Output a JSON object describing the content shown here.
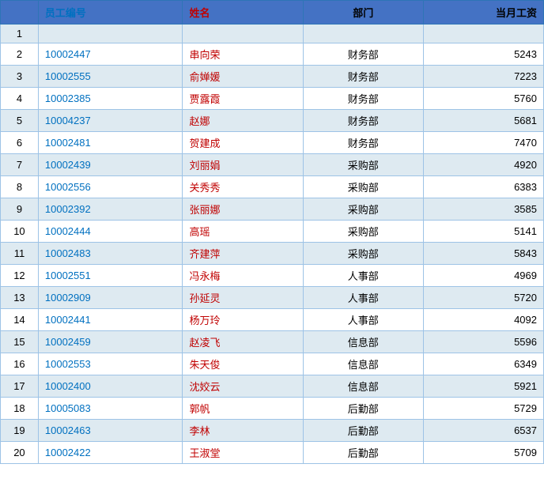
{
  "table": {
    "headers": [
      "",
      "员工编号",
      "姓名",
      "部门",
      "当月工资"
    ],
    "rows": [
      {
        "index": "1",
        "id": "",
        "name": "",
        "dept": "",
        "salary": ""
      },
      {
        "index": "2",
        "id": "10002447",
        "name": "串向荣",
        "dept": "财务部",
        "salary": "5243"
      },
      {
        "index": "3",
        "id": "10002555",
        "name": "俞婵媛",
        "dept": "财务部",
        "salary": "7223"
      },
      {
        "index": "4",
        "id": "10002385",
        "name": "贾露霞",
        "dept": "财务部",
        "salary": "5760"
      },
      {
        "index": "5",
        "id": "10004237",
        "name": "赵娜",
        "dept": "财务部",
        "salary": "5681"
      },
      {
        "index": "6",
        "id": "10002481",
        "name": "贺建成",
        "dept": "财务部",
        "salary": "7470"
      },
      {
        "index": "7",
        "id": "10002439",
        "name": "刘丽娟",
        "dept": "采购部",
        "salary": "4920"
      },
      {
        "index": "8",
        "id": "10002556",
        "name": "关秀秀",
        "dept": "采购部",
        "salary": "6383"
      },
      {
        "index": "9",
        "id": "10002392",
        "name": "张丽娜",
        "dept": "采购部",
        "salary": "3585"
      },
      {
        "index": "10",
        "id": "10002444",
        "name": "高瑶",
        "dept": "采购部",
        "salary": "5141"
      },
      {
        "index": "11",
        "id": "10002483",
        "name": "齐建萍",
        "dept": "采购部",
        "salary": "5843"
      },
      {
        "index": "12",
        "id": "10002551",
        "name": "冯永梅",
        "dept": "人事部",
        "salary": "4969"
      },
      {
        "index": "13",
        "id": "10002909",
        "name": "孙延灵",
        "dept": "人事部",
        "salary": "5720"
      },
      {
        "index": "14",
        "id": "10002441",
        "name": "杨万玲",
        "dept": "人事部",
        "salary": "4092"
      },
      {
        "index": "15",
        "id": "10002459",
        "name": "赵凌飞",
        "dept": "信息部",
        "salary": "5596"
      },
      {
        "index": "16",
        "id": "10002553",
        "name": "朱天俊",
        "dept": "信息部",
        "salary": "6349"
      },
      {
        "index": "17",
        "id": "10002400",
        "name": "沈姣云",
        "dept": "信息部",
        "salary": "5921"
      },
      {
        "index": "18",
        "id": "10005083",
        "name": "郭帆",
        "dept": "后勤部",
        "salary": "5729"
      },
      {
        "index": "19",
        "id": "10002463",
        "name": "李林",
        "dept": "后勤部",
        "salary": "6537"
      },
      {
        "index": "20",
        "id": "10002422",
        "name": "王淑堂",
        "dept": "后勤部",
        "salary": "5709"
      }
    ]
  }
}
